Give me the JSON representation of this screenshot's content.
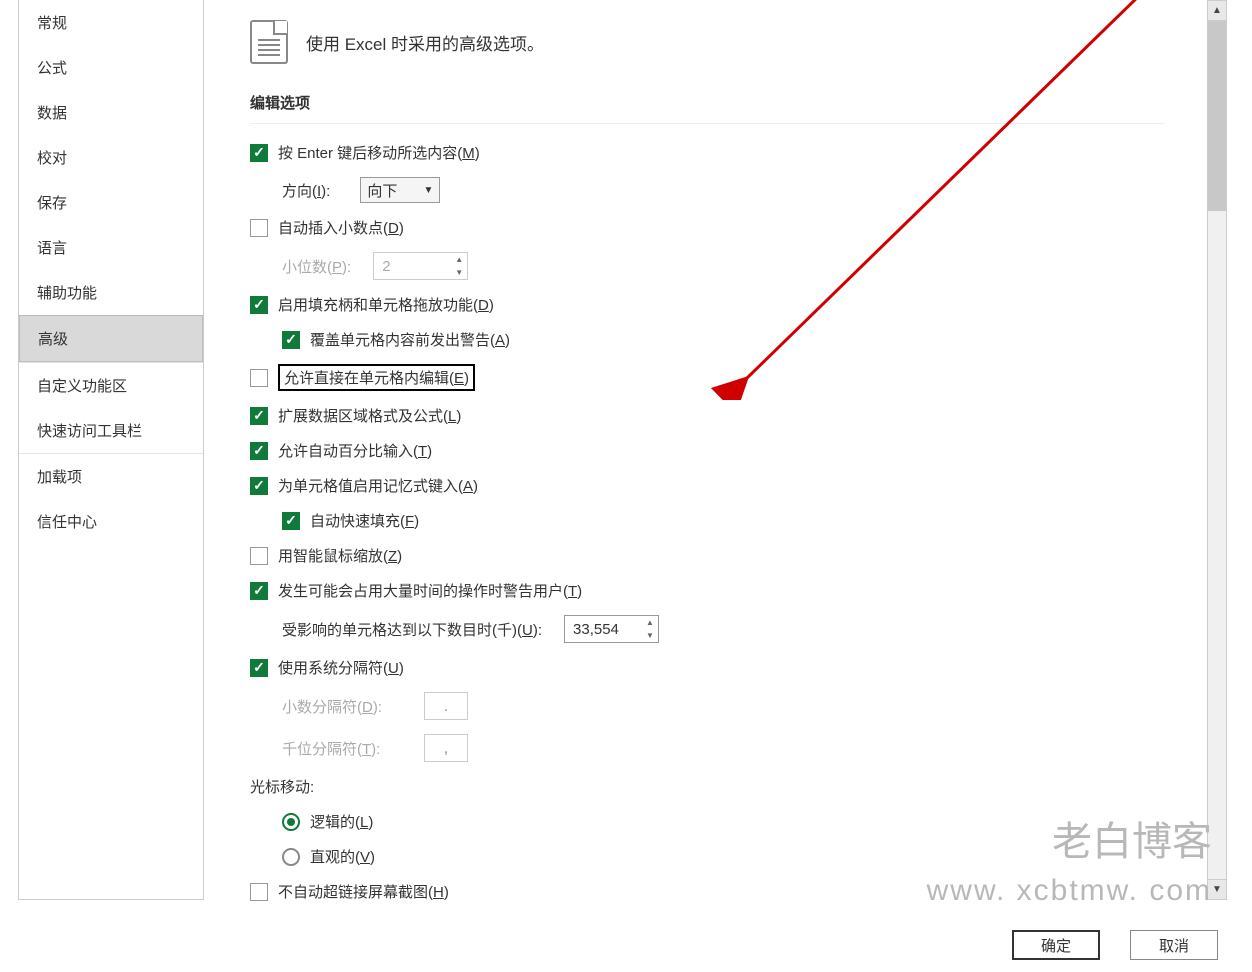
{
  "sidebar": {
    "items": [
      {
        "label": "常规"
      },
      {
        "label": "公式"
      },
      {
        "label": "数据"
      },
      {
        "label": "校对"
      },
      {
        "label": "保存"
      },
      {
        "label": "语言"
      },
      {
        "label": "辅助功能"
      },
      {
        "label": "高级"
      },
      {
        "label": "自定义功能区"
      },
      {
        "label": "快速访问工具栏"
      },
      {
        "label": "加载项"
      },
      {
        "label": "信任中心"
      }
    ],
    "selected_index": 7
  },
  "header": {
    "text": "使用 Excel 时采用的高级选项。"
  },
  "section": {
    "title": "编辑选项"
  },
  "move_after_enter": {
    "label": "按 Enter 键后移动所选内容(",
    "u": "M",
    "tail": ")"
  },
  "direction": {
    "label": "方向(",
    "u": "I",
    "tail": "):",
    "value": "向下"
  },
  "auto_decimal": {
    "label": "自动插入小数点(",
    "u": "D",
    "tail": ")"
  },
  "places": {
    "label": "小位数(",
    "u": "P",
    "tail": "):",
    "value": "2"
  },
  "fill_handle": {
    "label": "启用填充柄和单元格拖放功能(",
    "u": "D",
    "tail": ")"
  },
  "overwrite_warn": {
    "label": "覆盖单元格内容前发出警告(",
    "u": "A",
    "tail": ")"
  },
  "edit_in_cell": {
    "label": "允许直接在单元格内编辑(",
    "u": "E",
    "tail": ")"
  },
  "extend_formats": {
    "label": "扩展数据区域格式及公式(",
    "u": "L",
    "tail": ")"
  },
  "percent_entry": {
    "label": "允许自动百分比输入(",
    "u": "T",
    "tail": ")"
  },
  "autocomplete": {
    "label": "为单元格值启用记忆式键入(",
    "u": "A",
    "tail": ")"
  },
  "flashfill": {
    "label": "自动快速填充(",
    "u": "F",
    "tail": ")"
  },
  "intellimouse": {
    "label": "用智能鼠标缩放(",
    "u": "Z",
    "tail": ")"
  },
  "time_warn": {
    "label": "发生可能会占用大量时间的操作时警告用户(",
    "u": "T",
    "tail": ")"
  },
  "cells_affected": {
    "label": "受影响的单元格达到以下数目时(千)(",
    "u": "U",
    "tail": "):",
    "value": "33,554"
  },
  "sys_sep": {
    "label": "使用系统分隔符(",
    "u": "U",
    "tail": ")"
  },
  "dec_sep": {
    "label": "小数分隔符(",
    "u": "D",
    "tail": "):",
    "value": "."
  },
  "thou_sep": {
    "label": "千位分隔符(",
    "u": "T",
    "tail": "):",
    "value": ","
  },
  "cursor_move": {
    "label": "光标移动:"
  },
  "logical": {
    "label": "逻辑的(",
    "u": "L",
    "tail": ")"
  },
  "visual": {
    "label": "直观的(",
    "u": "V",
    "tail": ")"
  },
  "no_screenshot": {
    "label": "不自动超链接屏幕截图(",
    "u": "H",
    "tail": ")"
  },
  "buttons": {
    "ok": "确定",
    "cancel": "取消"
  },
  "watermark": {
    "line1": "老白博客",
    "line2": "www. xcbtmw. com"
  }
}
